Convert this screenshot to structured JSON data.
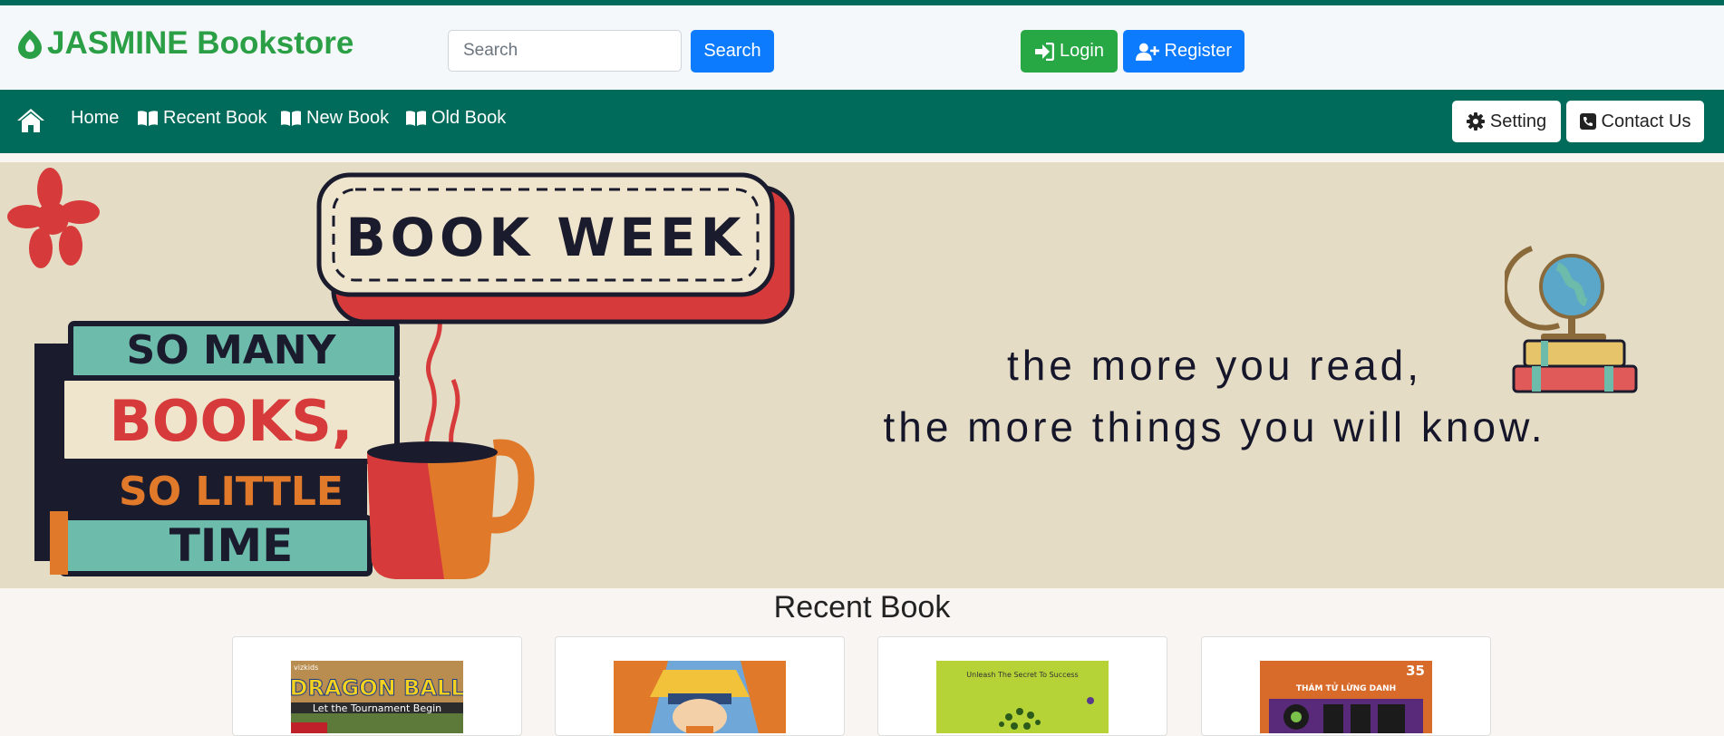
{
  "brand": {
    "name": "JASMINE Bookstore",
    "color": "#2b9f45"
  },
  "search": {
    "placeholder": "Search",
    "button_label": "Search"
  },
  "auth": {
    "login_label": "Login",
    "register_label": "Register"
  },
  "nav": {
    "home_icon": "home-icon",
    "items": [
      {
        "label": "Home"
      },
      {
        "label": "Recent Book",
        "icon": "book-open-icon"
      },
      {
        "label": "New Book",
        "icon": "book-open-icon"
      },
      {
        "label": "Old Book",
        "icon": "book-open-icon"
      }
    ],
    "setting_label": "Setting",
    "contact_label": "Contact Us"
  },
  "banner": {
    "badge": "BOOK WEEK",
    "stack_lines": [
      "SO MANY",
      "BOOKS,",
      "SO LITTLE",
      "TIME"
    ],
    "slogan_line1": "the more you read,",
    "slogan_line2": "the more things you will know."
  },
  "recent": {
    "title": "Recent Book",
    "books": [
      {
        "cover_brand": "vizkids",
        "cover_title": "DRAGON BALL",
        "cover_subtitle": "Let the Tournament Begin"
      },
      {
        "cover_title": ""
      },
      {
        "cover_title": "Unleash The Secret To Success"
      },
      {
        "cover_number": "35",
        "cover_title": "THÁM TỬ LỪNG DANH"
      }
    ]
  },
  "colors": {
    "primary": "#0d7bfe",
    "success": "#28a745",
    "nav_bg": "#006b5a",
    "banner_bg": "#e5dcc6"
  }
}
